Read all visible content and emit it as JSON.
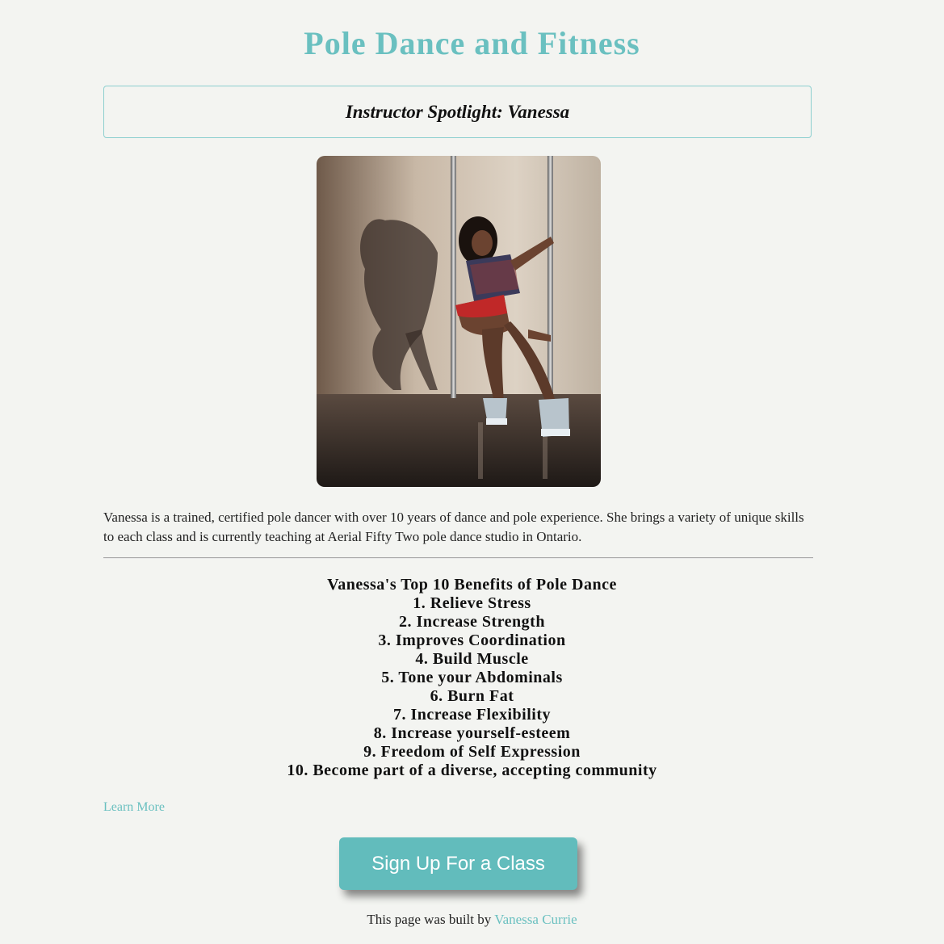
{
  "header": {
    "title": "Pole Dance and Fitness"
  },
  "spotlight": {
    "heading": "Instructor Spotlight: Vanessa"
  },
  "bio": {
    "text": "Vanessa is a trained, certified pole dancer with over 10 years of dance and pole experience. She brings a variety of unique skills to each class and is currently teaching at Aerial Fifty Two pole dance studio in Ontario."
  },
  "benefits": {
    "heading": "Vanessa's Top 10 Benefits of Pole Dance",
    "items": [
      "1. Relieve Stress",
      "2. Increase Strength",
      "3. Improves Coordination",
      "4. Build Muscle",
      "5. Tone your Abdominals",
      "6. Burn Fat",
      "7. Increase Flexibility",
      "8. Increase yourself-esteem",
      "9. Freedom of Self Expression",
      "10. Become part of a diverse, accepting community"
    ]
  },
  "links": {
    "learn_more": "Learn More"
  },
  "cta": {
    "signup_label": "Sign Up For a Class"
  },
  "footer": {
    "prefix": "This page was built by",
    "author": "Vanessa Currie"
  },
  "colors": {
    "accent": "#6ac0c0",
    "button": "#62bcbc",
    "background": "#f3f4f1"
  }
}
